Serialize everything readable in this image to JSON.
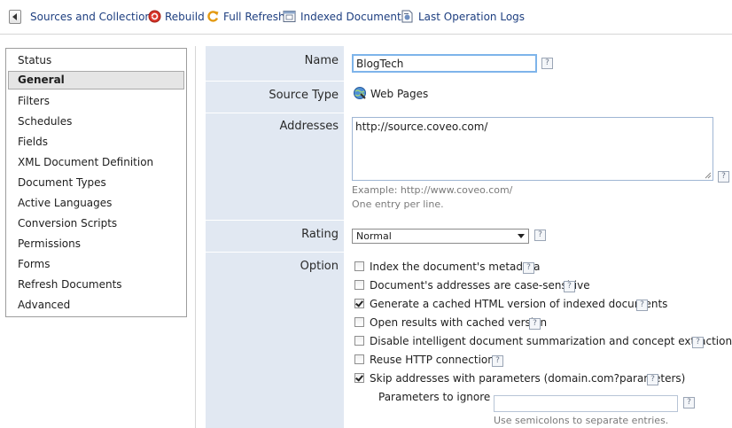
{
  "toolbar": {
    "items": [
      {
        "label": "Sources and Collections",
        "icon": "back-arrow-icon"
      },
      {
        "label": "Rebuild",
        "icon": "rebuild-icon"
      },
      {
        "label": "Full Refresh",
        "icon": "refresh-icon"
      },
      {
        "label": "Indexed Documents",
        "icon": "documents-icon"
      },
      {
        "label": "Last Operation Logs",
        "icon": "logs-icon"
      }
    ]
  },
  "sidebar": {
    "items": [
      {
        "label": "Status"
      },
      {
        "label": "General",
        "selected": true
      },
      {
        "label": "Filters"
      },
      {
        "label": "Schedules"
      },
      {
        "label": "Fields"
      },
      {
        "label": "XML Document Definition"
      },
      {
        "label": "Document Types"
      },
      {
        "label": "Active Languages"
      },
      {
        "label": "Conversion Scripts"
      },
      {
        "label": "Permissions"
      },
      {
        "label": "Forms"
      },
      {
        "label": "Refresh Documents"
      },
      {
        "label": "Advanced"
      }
    ]
  },
  "form": {
    "name": {
      "label": "Name",
      "value": "BlogTech"
    },
    "source_type": {
      "label": "Source Type",
      "value": "Web Pages",
      "icon": "web-pages-icon"
    },
    "addresses": {
      "label": "Addresses",
      "value": "http://source.coveo.com/",
      "hint_example": "Example: http://www.coveo.com/",
      "hint_line": "One entry per line."
    },
    "rating": {
      "label": "Rating",
      "value": "Normal"
    },
    "option": {
      "label": "Option",
      "items": [
        {
          "label": "Index the document's metadata",
          "checked": false
        },
        {
          "label": "Document's addresses are case-sensitive",
          "checked": false
        },
        {
          "label": "Generate a cached HTML version of indexed documents",
          "checked": true
        },
        {
          "label": "Open results with cached version",
          "checked": false
        },
        {
          "label": "Disable intelligent document summarization and concept extraction",
          "checked": false
        },
        {
          "label": "Reuse HTTP connections",
          "checked": false
        },
        {
          "label": "Skip addresses with parameters (domain.com?parameters)",
          "checked": true
        }
      ],
      "parameters_label": "Parameters to ignore",
      "parameters_value": "",
      "parameters_hint": "Use semicolons to separate entries."
    },
    "help_glyph": "?"
  },
  "colors": {
    "label_column_bg": "#e1e8f2",
    "link_text": "#1e3f80",
    "focus_border": "#7eb4ea"
  }
}
